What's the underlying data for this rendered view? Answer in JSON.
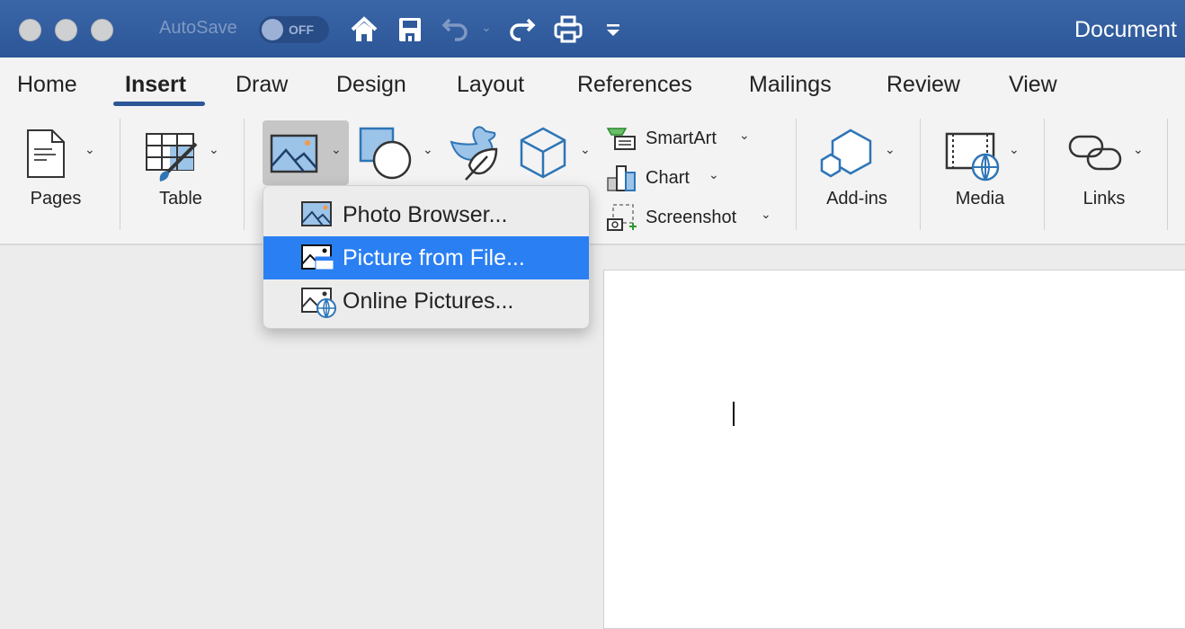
{
  "titlebar": {
    "autosave_label": "AutoSave",
    "autosave_state": "OFF",
    "document_title": "Document",
    "quick_access": [
      "home-icon",
      "save-icon",
      "undo-icon",
      "redo-icon",
      "print-icon",
      "customize-icon"
    ]
  },
  "tabs": [
    {
      "label": "Home"
    },
    {
      "label": "Insert",
      "active": true
    },
    {
      "label": "Draw"
    },
    {
      "label": "Design"
    },
    {
      "label": "Layout"
    },
    {
      "label": "References"
    },
    {
      "label": "Mailings"
    },
    {
      "label": "Review"
    },
    {
      "label": "View"
    }
  ],
  "ribbon": {
    "pages": "Pages",
    "table": "Table",
    "smartart": "SmartArt",
    "chart": "Chart",
    "screenshot": "Screenshot",
    "addins": "Add-ins",
    "media": "Media",
    "links": "Links"
  },
  "pictures_menu": {
    "items": [
      {
        "label": "Photo Browser..."
      },
      {
        "label": "Picture from File...",
        "highlighted": true
      },
      {
        "label": "Online Pictures..."
      }
    ]
  },
  "colors": {
    "titlebar": "#2c5697",
    "accent": "#2b5797",
    "menu_highlight": "#2a7ff2",
    "icon_blue": "#2e75b6"
  }
}
